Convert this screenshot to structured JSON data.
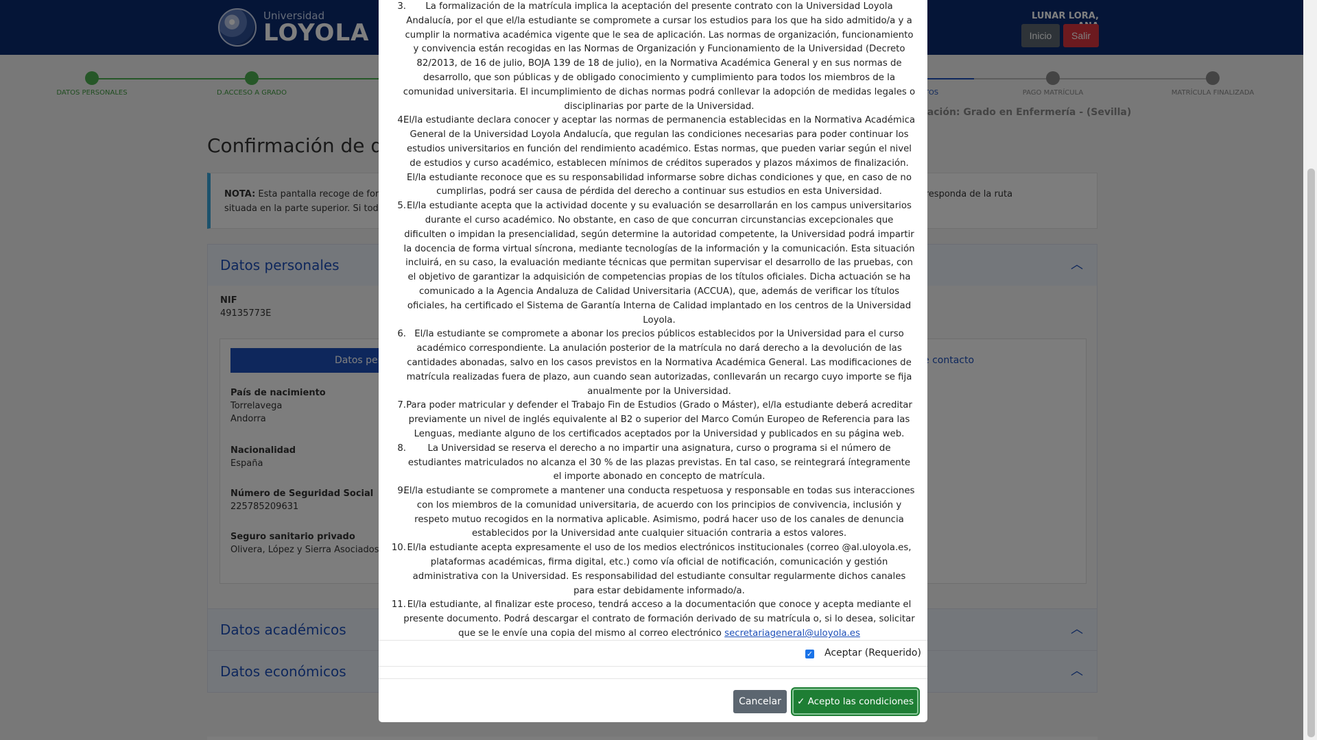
{
  "header": {
    "logo_small": "Universidad",
    "logo_big": "LOYOLA",
    "user_name": "LUNAR LORA, ANA",
    "btn_inicio": "Inicio",
    "btn_salir": "Salir"
  },
  "steps": [
    {
      "label": "DATOS PERSONALES"
    },
    {
      "label": "D.ACCESO A GRADO"
    },
    {
      "label": "P"
    },
    {
      "label": "TOS"
    },
    {
      "label": "PAGO MATRÍCULA"
    },
    {
      "label": "MATRÍCULA FINALIZADA"
    }
  ],
  "titulacion": "lación: Grado en Enfermería - (Sevilla)",
  "page_title": "Confirmación de dat",
  "note": {
    "bold": "NOTA:",
    "line1": " Esta pantalla recoge de form",
    "line1_right": "o el paso que corresponda de la ruta",
    "line2": "situada en la parte superior. Si todo"
  },
  "panels": {
    "personal": "Datos personales",
    "academic": "Datos académicos",
    "economic": "Datos económicos"
  },
  "personal": {
    "nif_label": "NIF",
    "nif_value": "49135773E",
    "tab_active": "Datos pers",
    "tab_contact": "e contacto",
    "pais_label": "País de nacimiento",
    "pais_value1": "Torrelavega",
    "pais_value2": "Andorra",
    "nac_label": "Nacionalidad",
    "nac_value": "España",
    "nss_label": "Número de Seguridad Social",
    "nss_value": "225785209631",
    "seguro_label": "Seguro sanitario privado",
    "seguro_value": "Olivera, López y Sierra Asociados -"
  },
  "modal": {
    "terms": [
      {
        "num": "3.",
        "text": "La formalización de la matrícula implica la aceptación del presente contrato con la Universidad Loyola Andalucía, por el que el/la estudiante se compromete a cursar los estudios para los que ha sido admitido/a y a cumplir la normativa académica vigente que le sea de aplicación. Las normas de organización, funcionamiento y convivencia están recogidas en las Normas de Organización y Funcionamiento de la Universidad (Decreto 82/2013, de 16 de julio, BOJA 139 de 18 de julio), en la Normativa Académica General y en sus normas de desarrollo, que son públicas y de obligado conocimiento y cumplimiento para todos los miembros de la comunidad universitaria. El incumplimiento de dichas normas podrá conllevar la adopción de medidas legales o disciplinarias por parte de la Universidad."
      },
      {
        "num": "4.",
        "text": "El/la estudiante declara conocer y aceptar las normas de permanencia establecidas en la Normativa Académica General de la Universidad Loyola Andalucía, que regulan las condiciones necesarias para poder continuar los estudios universitarios en función del rendimiento académico. Estas normas, que pueden variar según el nivel de estudios y curso académico, establecen mínimos de créditos superados y plazos máximos de finalización. El/la estudiante reconoce que es su responsabilidad informarse sobre dichas condiciones y que, en caso de no cumplirlas, podrá ser causa de pérdida del derecho a continuar sus estudios en esta Universidad."
      },
      {
        "num": "5.",
        "text": "El/la estudiante acepta que la actividad docente y su evaluación se desarrollarán en los campus universitarios durante el curso académico. No obstante, en caso de que concurran circunstancias excepcionales que dificulten o impidan la presencialidad, según determine la autoridad competente, la Universidad podrá impartir la docencia de forma virtual síncrona, mediante tecnologías de la información y la comunicación. Esta situación incluirá, en su caso, la evaluación mediante técnicas que permitan supervisar el desarrollo de las pruebas, con el objetivo de garantizar la adquisición de competencias propias de los títulos oficiales. Dicha actuación se ha comunicado a la Agencia Andaluza de Calidad Universitaria (ACCUA), que, además de verificar los títulos oficiales, ha certificado el Sistema de Garantía Interna de Calidad implantado en los centros de la Universidad Loyola."
      },
      {
        "num": "6.",
        "text": "El/la estudiante se compromete a abonar los precios públicos establecidos por la Universidad para el curso académico correspondiente. La anulación posterior de la matrícula no dará derecho a la devolución de las cantidades abonadas, salvo en los casos previstos en la Normativa Académica General. Las modificaciones de matrícula realizadas fuera de plazo, aun cuando sean autorizadas, conllevarán un recargo cuyo importe se fija anualmente por la Universidad."
      },
      {
        "num": "7.",
        "text": "Para poder matricular y defender el Trabajo Fin de Estudios (Grado o Máster), el/la estudiante deberá acreditar previamente un nivel de inglés equivalente al B2 o superior del Marco Común Europeo de Referencia para las Lenguas, mediante alguno de los certificados aceptados por la Universidad y publicados en su página web."
      },
      {
        "num": "8.",
        "text": "La Universidad se reserva el derecho a no impartir una asignatura, curso o programa si el número de estudiantes matriculados no alcanza el 30 % de las plazas previstas. En tal caso, se reintegrará íntegramente el importe abonado en concepto de matrícula."
      },
      {
        "num": "9.",
        "text": "El/la estudiante se compromete a mantener una conducta respetuosa y responsable en todas sus interacciones con los miembros de la comunidad universitaria, de acuerdo con los principios de convivencia, inclusión y respeto mutuo recogidos en la normativa aplicable. Asimismo, podrá hacer uso de los canales de denuncia establecidos por la Universidad ante cualquier situación contraria a estos valores."
      },
      {
        "num": "10.",
        "text": "El/la estudiante acepta expresamente el uso de los medios electrónicos institucionales (correo @al.uloyola.es, plataformas académicas, firma digital, etc.) como vía oficial de notificación, comunicación y gestión administrativa con la Universidad. Es responsabilidad del estudiante consultar regularmente dichos canales para estar debidamente informado/a."
      },
      {
        "num": "11.",
        "text": "El/la estudiante, al finalizar este proceso, tendrá acceso a la documentación que conoce y acepta mediante el presente documento. Podrá descargar el contrato de formación derivado de su matrícula o, si lo desea, solicitar que se le envíe una copia del mismo al correo electrónico ",
        "link": "secretariageneral@uloyola.es"
      }
    ],
    "accept_label": "Aceptar (Requerido)",
    "btn_cancel": "Cancelar",
    "btn_accept": "Acepto las condiciones",
    "accept_color": "#1e7e34"
  }
}
